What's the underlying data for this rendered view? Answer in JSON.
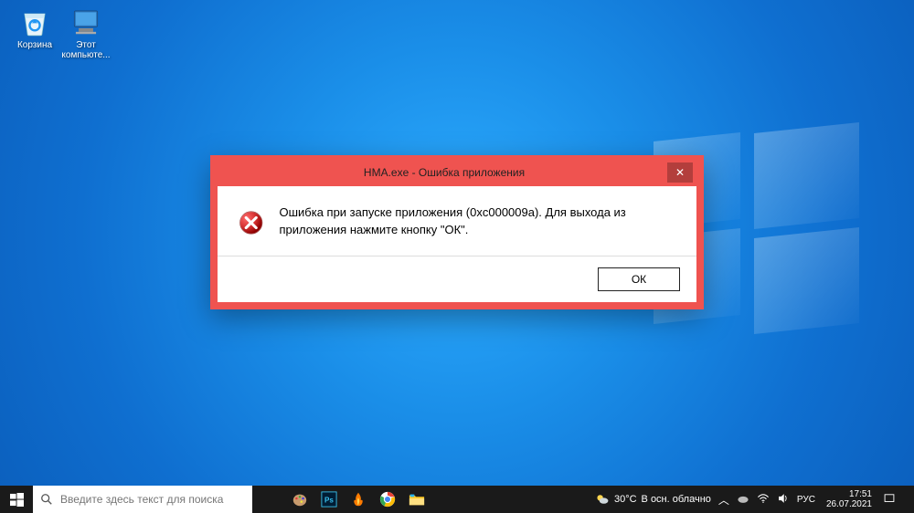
{
  "desktop": {
    "recycle_label": "Корзина",
    "thispc_label": "Этот компьюте..."
  },
  "dialog": {
    "title": "HMA.exe - Ошибка приложения",
    "message": "Ошибка при запуске приложения (0xc000009a). Для выхода из приложения нажмите кнопку \"ОК\".",
    "ok_label": "ОК"
  },
  "taskbar": {
    "search_placeholder": "Введите здесь текст для поиска",
    "weather_temp": "30°C",
    "weather_text": "В осн. облачно",
    "lang": "РУС",
    "time": "17:51",
    "date": "26.07.2021"
  }
}
